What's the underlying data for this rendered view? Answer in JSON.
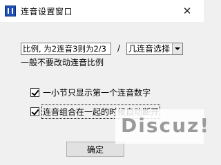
{
  "window": {
    "title": "连音设置窗口",
    "close_glyph": "✕"
  },
  "ratio": {
    "value": "比例, 为2连音3则为2/3",
    "slash": "/",
    "select_value": "几连音选择"
  },
  "hint": "一般不要改动连音比例",
  "options": [
    {
      "label": "一小节只显示第一个连音数字",
      "checked": true
    },
    {
      "label": "连音组合在一起的时候自动断开",
      "checked": true
    }
  ],
  "ok_label": "确定",
  "watermark": "Discuz!"
}
